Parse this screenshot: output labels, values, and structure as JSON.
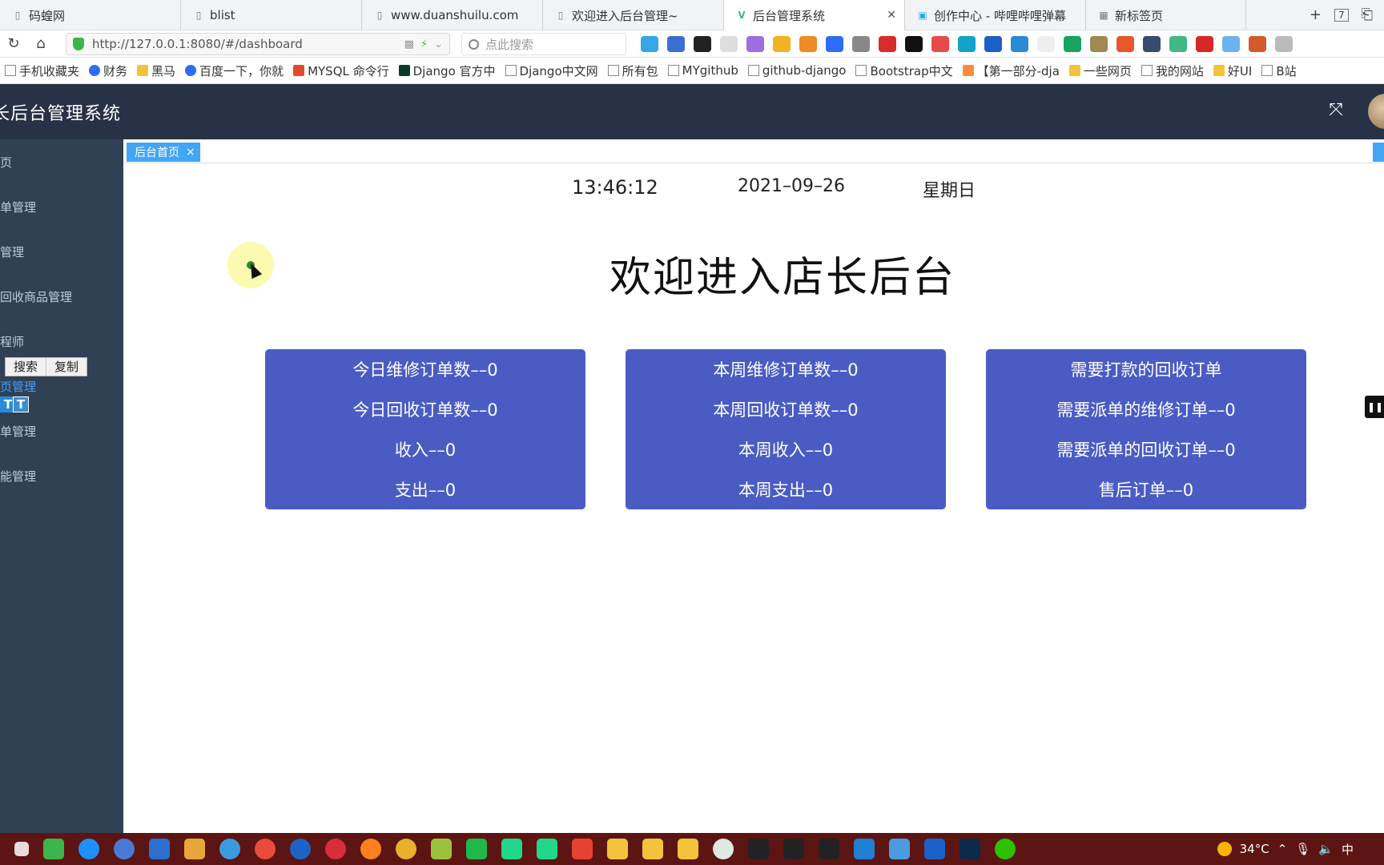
{
  "browser": {
    "tabs": [
      {
        "title": "码蝗网",
        "active": false
      },
      {
        "title": "blist",
        "active": false
      },
      {
        "title": "www.duanshuilu.com",
        "active": false
      },
      {
        "title": "欢迎进入后台管理~",
        "active": false
      },
      {
        "title": "后台管理系统",
        "active": true
      },
      {
        "title": "创作中心 - 哔哩哔哩弹幕",
        "active": false
      },
      {
        "title": "新标签页",
        "active": false
      }
    ],
    "tab_count_badge": "7",
    "url": "http://127.0.0.1:8080/#/dashboard",
    "search_placeholder": "点此搜索",
    "bookmarks": [
      "手机收藏夹",
      "财务",
      "黑马",
      "百度一下，你就",
      "MYSQL 命令行",
      "Django 官方中",
      "Django中文网",
      "所有包",
      "MYgithub",
      "github-django",
      "Bootstrap中文",
      "【第一部分-dja",
      "一些网页",
      "我的网站",
      "好UI",
      "B站"
    ]
  },
  "app": {
    "title": "长后台管理系统",
    "sidebar": [
      {
        "label": "页"
      },
      {
        "label": "单管理"
      },
      {
        "label": "管理"
      },
      {
        "label": "回收商品管理"
      },
      {
        "label": "程师"
      },
      {
        "label": "页管理"
      },
      {
        "label": "单管理"
      },
      {
        "label": "能管理"
      }
    ],
    "popup": {
      "search": "搜索",
      "copy": "复制"
    },
    "tag": {
      "label": "后台首页",
      "close": "×"
    },
    "clock": {
      "time": "13:46:12",
      "date": "2021–09–26",
      "weekday": "星期日"
    },
    "welcome": "欢迎进入店长后台",
    "cards": [
      {
        "lines": [
          "今日维修订单数––0",
          "今日回收订单数––0",
          "收入––0",
          "支出––0"
        ]
      },
      {
        "lines": [
          "本周维修订单数––0",
          "本周回收订单数––0",
          "本周收入––0",
          "本周支出––0"
        ]
      },
      {
        "lines": [
          "需要打款的回收订单",
          "需要派单的维修订单––0",
          "需要派单的回收订单––0",
          "售后订单––0"
        ]
      }
    ]
  },
  "taskbar": {
    "temperature": "34°C",
    "ime": "中"
  },
  "colors": {
    "header_bg": "#273246",
    "sidebar_bg": "#304156",
    "card_bg": "#4a5cc4",
    "tag_bg": "#42a5f5",
    "taskbar_bg": "#5c1513"
  }
}
